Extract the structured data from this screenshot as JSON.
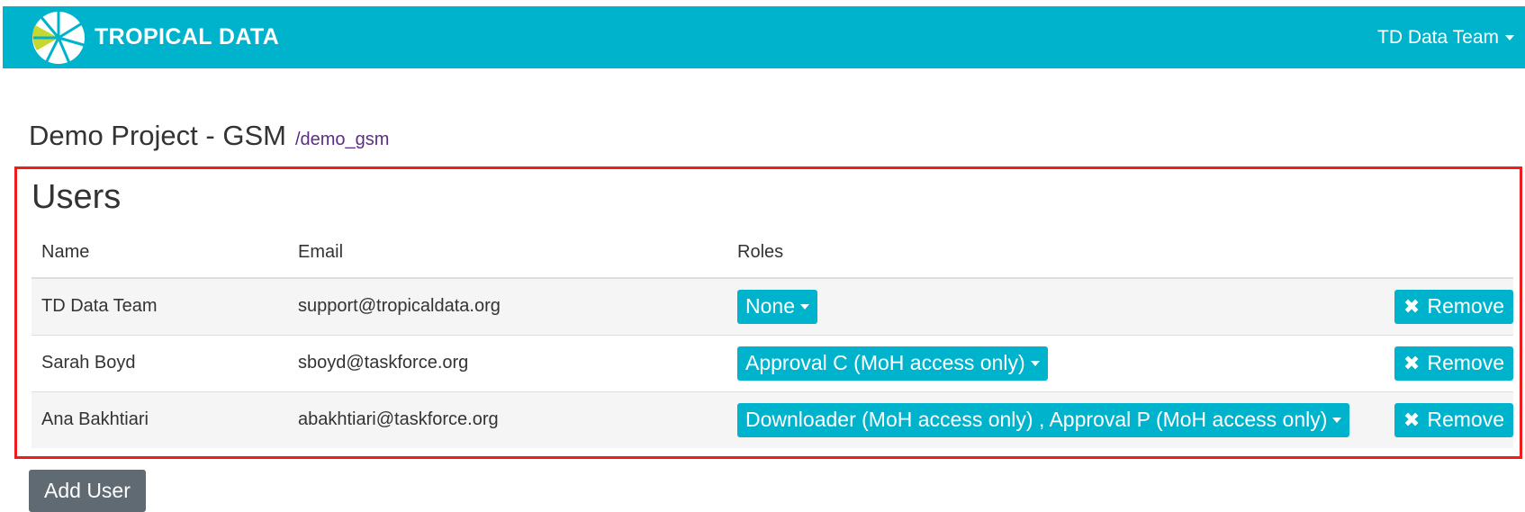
{
  "navbar": {
    "brand": "TROPICAL DATA",
    "user_menu_label": "TD Data Team",
    "bg_color": "#00b3cc"
  },
  "project": {
    "title": "Demo Project - GSM",
    "slug": "/demo_gsm"
  },
  "users": {
    "heading": "Users",
    "columns": {
      "name": "Name",
      "email": "Email",
      "roles": "Roles"
    },
    "rows": [
      {
        "name": "TD Data Team",
        "email": "support@tropicaldata.org",
        "roles": "None",
        "remove_label": "Remove"
      },
      {
        "name": "Sarah Boyd",
        "email": "sboyd@taskforce.org",
        "roles": "Approval C (MoH access only)",
        "remove_label": "Remove"
      },
      {
        "name": "Ana Bakhtiari",
        "email": "abakhtiari@taskforce.org",
        "roles": "Downloader (MoH access only) , Approval P (MoH access only)",
        "remove_label": "Remove"
      }
    ],
    "highlight_color": "#ee1c1c"
  },
  "add_user_label": "Add User",
  "icons": {
    "logo": "tropical-data-logo",
    "caret": "caret-down-icon",
    "remove": "x-icon"
  }
}
